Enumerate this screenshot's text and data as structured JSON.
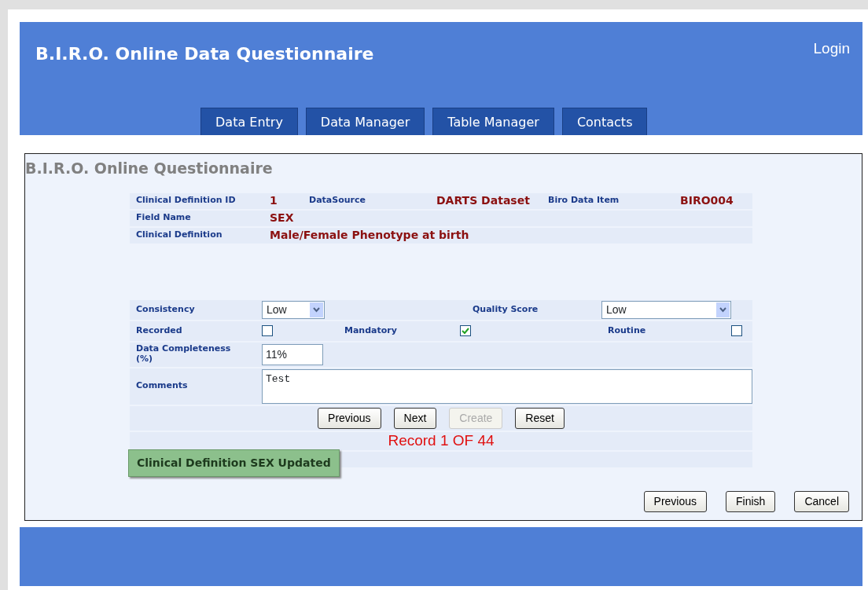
{
  "header": {
    "title": "B.I.R.O. Online Data Questionnaire",
    "login": "Login"
  },
  "tabs": [
    {
      "label": "Data Entry",
      "selected": false
    },
    {
      "label": "Data Manager",
      "selected": false
    },
    {
      "label": "Table Manager",
      "selected": false
    },
    {
      "label": "Contacts",
      "selected": false
    }
  ],
  "panel": {
    "title": "B.I.R.O. Online Questionnaire"
  },
  "definition": {
    "id_label": "Clinical Definition ID",
    "id": "1",
    "source_label": "DataSource",
    "source": "DARTS Dataset",
    "item_label": "Biro Data Item",
    "item": "BIRO004",
    "field_label": "Field Name",
    "field": "SEX",
    "definition_label": "Clinical Definition",
    "definition": "Male/Female Phenotype at birth"
  },
  "form": {
    "consistency": {
      "label": "Consistency",
      "value": "Low"
    },
    "quality_score": {
      "label": "Quality Score",
      "value": "Low"
    },
    "recorded": {
      "label": "Recorded",
      "checked": false
    },
    "mandatory": {
      "label": "Mandatory",
      "checked": true
    },
    "routine": {
      "label": "Routine",
      "checked": false
    },
    "completeness": {
      "label": "Data Completeness (%)",
      "value": "11%"
    },
    "comments": {
      "label": "Comments",
      "value": "Test"
    }
  },
  "record_buttons": [
    {
      "label": "Previous",
      "disabled": false
    },
    {
      "label": "Next",
      "disabled": false
    },
    {
      "label": "Create",
      "disabled": true
    },
    {
      "label": "Reset",
      "disabled": false
    }
  ],
  "record_status": "Record 1 OF 44",
  "notice": "Clinical Definition SEX Updated",
  "nav_buttons": [
    {
      "label": "Previous"
    },
    {
      "label": "Finish"
    },
    {
      "label": "Cancel"
    }
  ]
}
